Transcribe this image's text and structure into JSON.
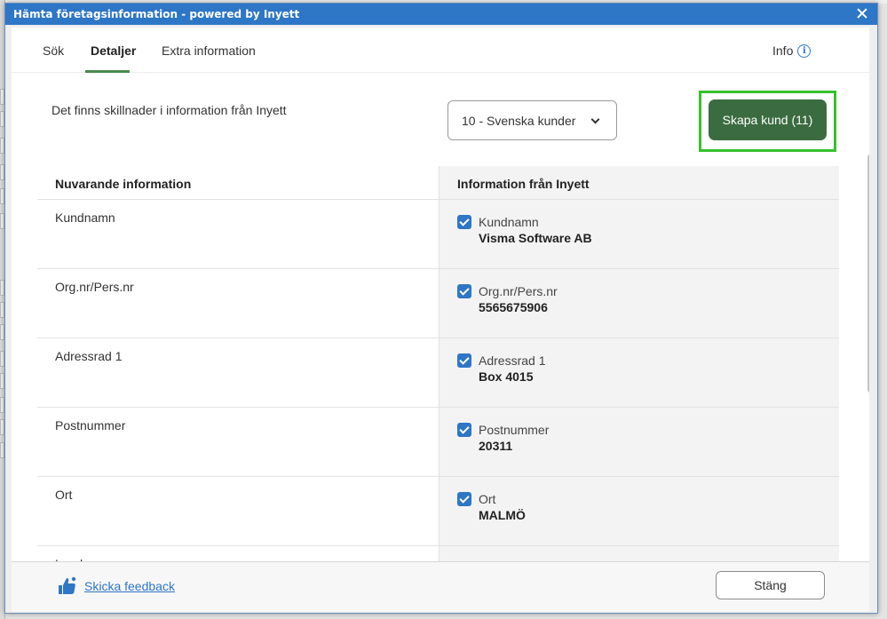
{
  "dialog": {
    "title": "Hämta företagsinformation - powered by Inyett"
  },
  "tabs": [
    {
      "label": "Sök"
    },
    {
      "label": "Detaljer"
    },
    {
      "label": "Extra information"
    }
  ],
  "info_label": "Info",
  "header": {
    "diff_text": "Det finns skillnader i information från Inyett",
    "customer_group": "10 - Svenska kunder",
    "create_label": "Skapa kund (11)"
  },
  "table": {
    "col_current": "Nuvarande information",
    "col_inyett": "Information från Inyett",
    "rows": [
      {
        "current": "Kundnamn",
        "label": "Kundnamn",
        "value": "Visma Software AB"
      },
      {
        "current": "Org.nr/Pers.nr",
        "label": "Org.nr/Pers.nr",
        "value": "5565675906"
      },
      {
        "current": "Adressrad 1",
        "label": "Adressrad 1",
        "value": "Box 4015"
      },
      {
        "current": "Postnummer",
        "label": "Postnummer",
        "value": "20311"
      },
      {
        "current": "Ort",
        "label": "Ort",
        "value": "MALMÖ"
      },
      {
        "current": "Land",
        "label": "",
        "value": ""
      }
    ]
  },
  "footer": {
    "feedback_label": "Skicka feedback",
    "close_label": "Stäng"
  },
  "colors": {
    "title_bar": "#2e76c6",
    "primary_button": "#3b6b40",
    "highlight": "#36c12c",
    "checkbox": "#2e76c6"
  }
}
